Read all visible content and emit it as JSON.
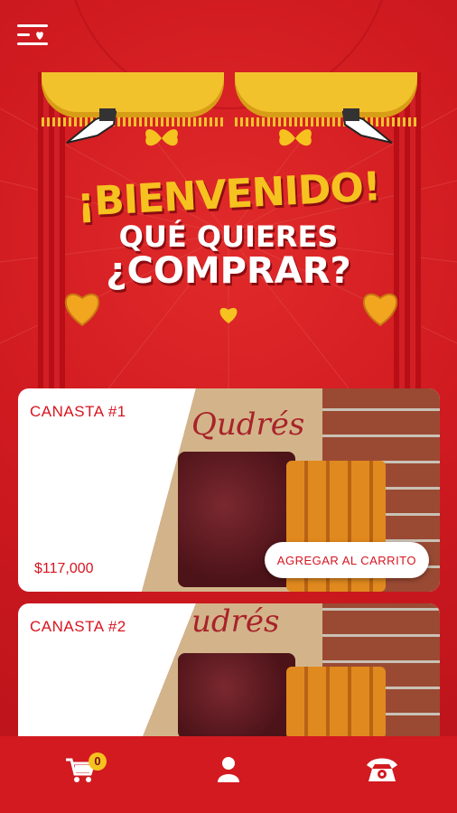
{
  "banner": {
    "line1": "¡BIENVENIDO!",
    "line2": "QUÉ QUIERES",
    "line3": "¿COMPRAR?"
  },
  "products": [
    {
      "title": "CANASTA #1",
      "price": "$117,000",
      "button": "AGREGAR AL CARRITO",
      "brand": "Qudrés"
    },
    {
      "title": "CANASTA #2",
      "brand": "udrés"
    }
  ],
  "nav": {
    "cart_count": "0",
    "icons": [
      "cart-icon",
      "user-icon",
      "phone-icon"
    ]
  },
  "colors": {
    "primary_red": "#d21a20",
    "accent_yellow": "#f6c21f",
    "card_text_red": "#d7151f"
  }
}
